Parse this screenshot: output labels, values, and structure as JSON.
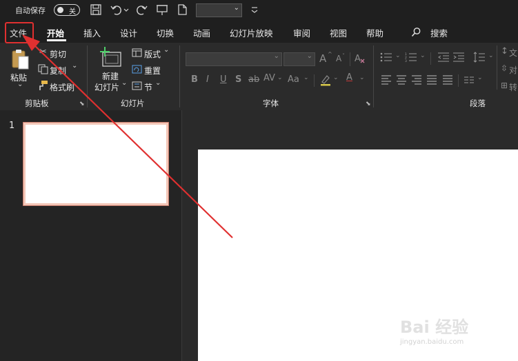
{
  "quick_access": {
    "autosave_label": "自动保存",
    "autosave_state": "关",
    "icons": [
      "save-icon",
      "undo-icon",
      "redo-icon",
      "present-icon",
      "new-file-icon"
    ]
  },
  "tabs": [
    {
      "label": "文件"
    },
    {
      "label": "开始"
    },
    {
      "label": "插入"
    },
    {
      "label": "设计"
    },
    {
      "label": "切换"
    },
    {
      "label": "动画"
    },
    {
      "label": "幻灯片放映"
    },
    {
      "label": "审阅"
    },
    {
      "label": "视图"
    },
    {
      "label": "帮助"
    },
    {
      "label": "搜索"
    }
  ],
  "active_tab": "开始",
  "ribbon": {
    "clipboard": {
      "paste": "粘贴",
      "cut": "剪切",
      "copy": "复制",
      "format_painter": "格式刷",
      "group": "剪贴板"
    },
    "slides": {
      "new_slide_line1": "新建",
      "new_slide_line2": "幻灯片",
      "layout": "版式",
      "reset": "重置",
      "section": "节",
      "group": "幻灯片"
    },
    "font": {
      "bold": "B",
      "italic": "I",
      "underline": "U",
      "shadow": "S",
      "strike": "ab",
      "spacing": "AV",
      "case": "Aa",
      "grow": "A",
      "shrink": "A",
      "font_color": "A",
      "group": "字体"
    },
    "paragraph": {
      "group": "段落",
      "text_dir": "文",
      "align_text": "对",
      "convert": "转"
    }
  },
  "slides": [
    {
      "number": "1"
    }
  ],
  "watermark": {
    "brand": "Bai 经验",
    "url": "jingyan.baidu.com"
  },
  "colors": {
    "annotation": "#e03030",
    "ribbon_bg": "#2b2b2b",
    "thumb_border": "#f4c7b8"
  }
}
